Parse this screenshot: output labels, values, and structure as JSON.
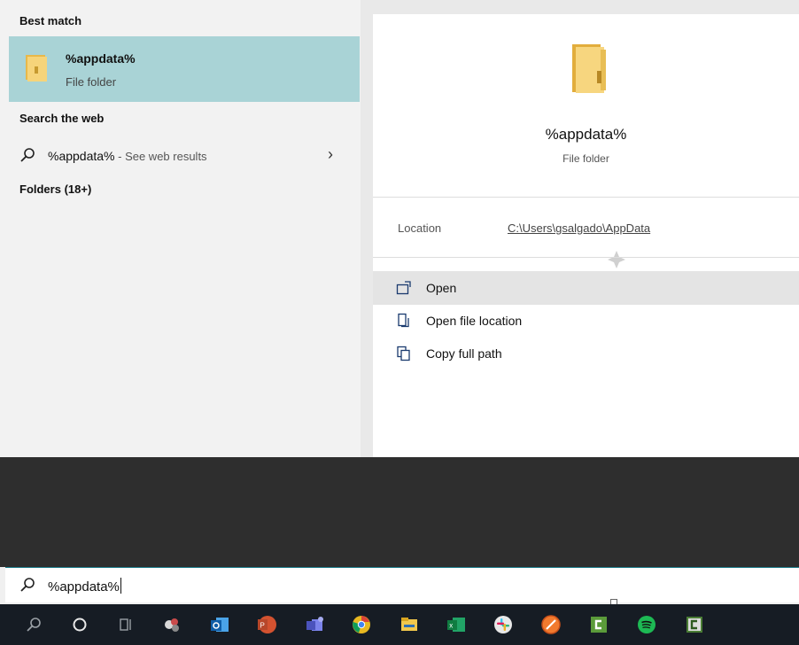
{
  "left_panel": {
    "best_match_heading": "Best match",
    "best_match": {
      "title": "%appdata%",
      "subtitle": "File folder"
    },
    "search_web_heading": "Search the web",
    "web_result": {
      "query": "%appdata%",
      "hint": " - See web results"
    },
    "folders_heading": "Folders (18+)"
  },
  "preview": {
    "title": "%appdata%",
    "subtitle": "File folder",
    "location_label": "Location",
    "location_value": "C:\\Users\\gsalgado\\AppData",
    "actions": [
      {
        "label": "Open",
        "icon": "open-icon"
      },
      {
        "label": "Open file location",
        "icon": "file-location-icon"
      },
      {
        "label": "Copy full path",
        "icon": "copy-icon"
      }
    ]
  },
  "search_box": {
    "value": "%appdata%"
  },
  "taskbar": {
    "icons": [
      "search-icon",
      "cortana-icon",
      "task-view-icon",
      "snipping-tool-icon",
      "outlook-icon",
      "powerpoint-icon",
      "teams-icon",
      "chrome-icon",
      "file-explorer-icon",
      "excel-icon",
      "slack-icon",
      "firefox-icon",
      "camtasia-icon",
      "spotify-icon",
      "camtasia-recorder-icon"
    ]
  },
  "colors": {
    "selection": "#a9d3d6",
    "taskbar": "#161c24",
    "accent": "#1d7e8c"
  }
}
